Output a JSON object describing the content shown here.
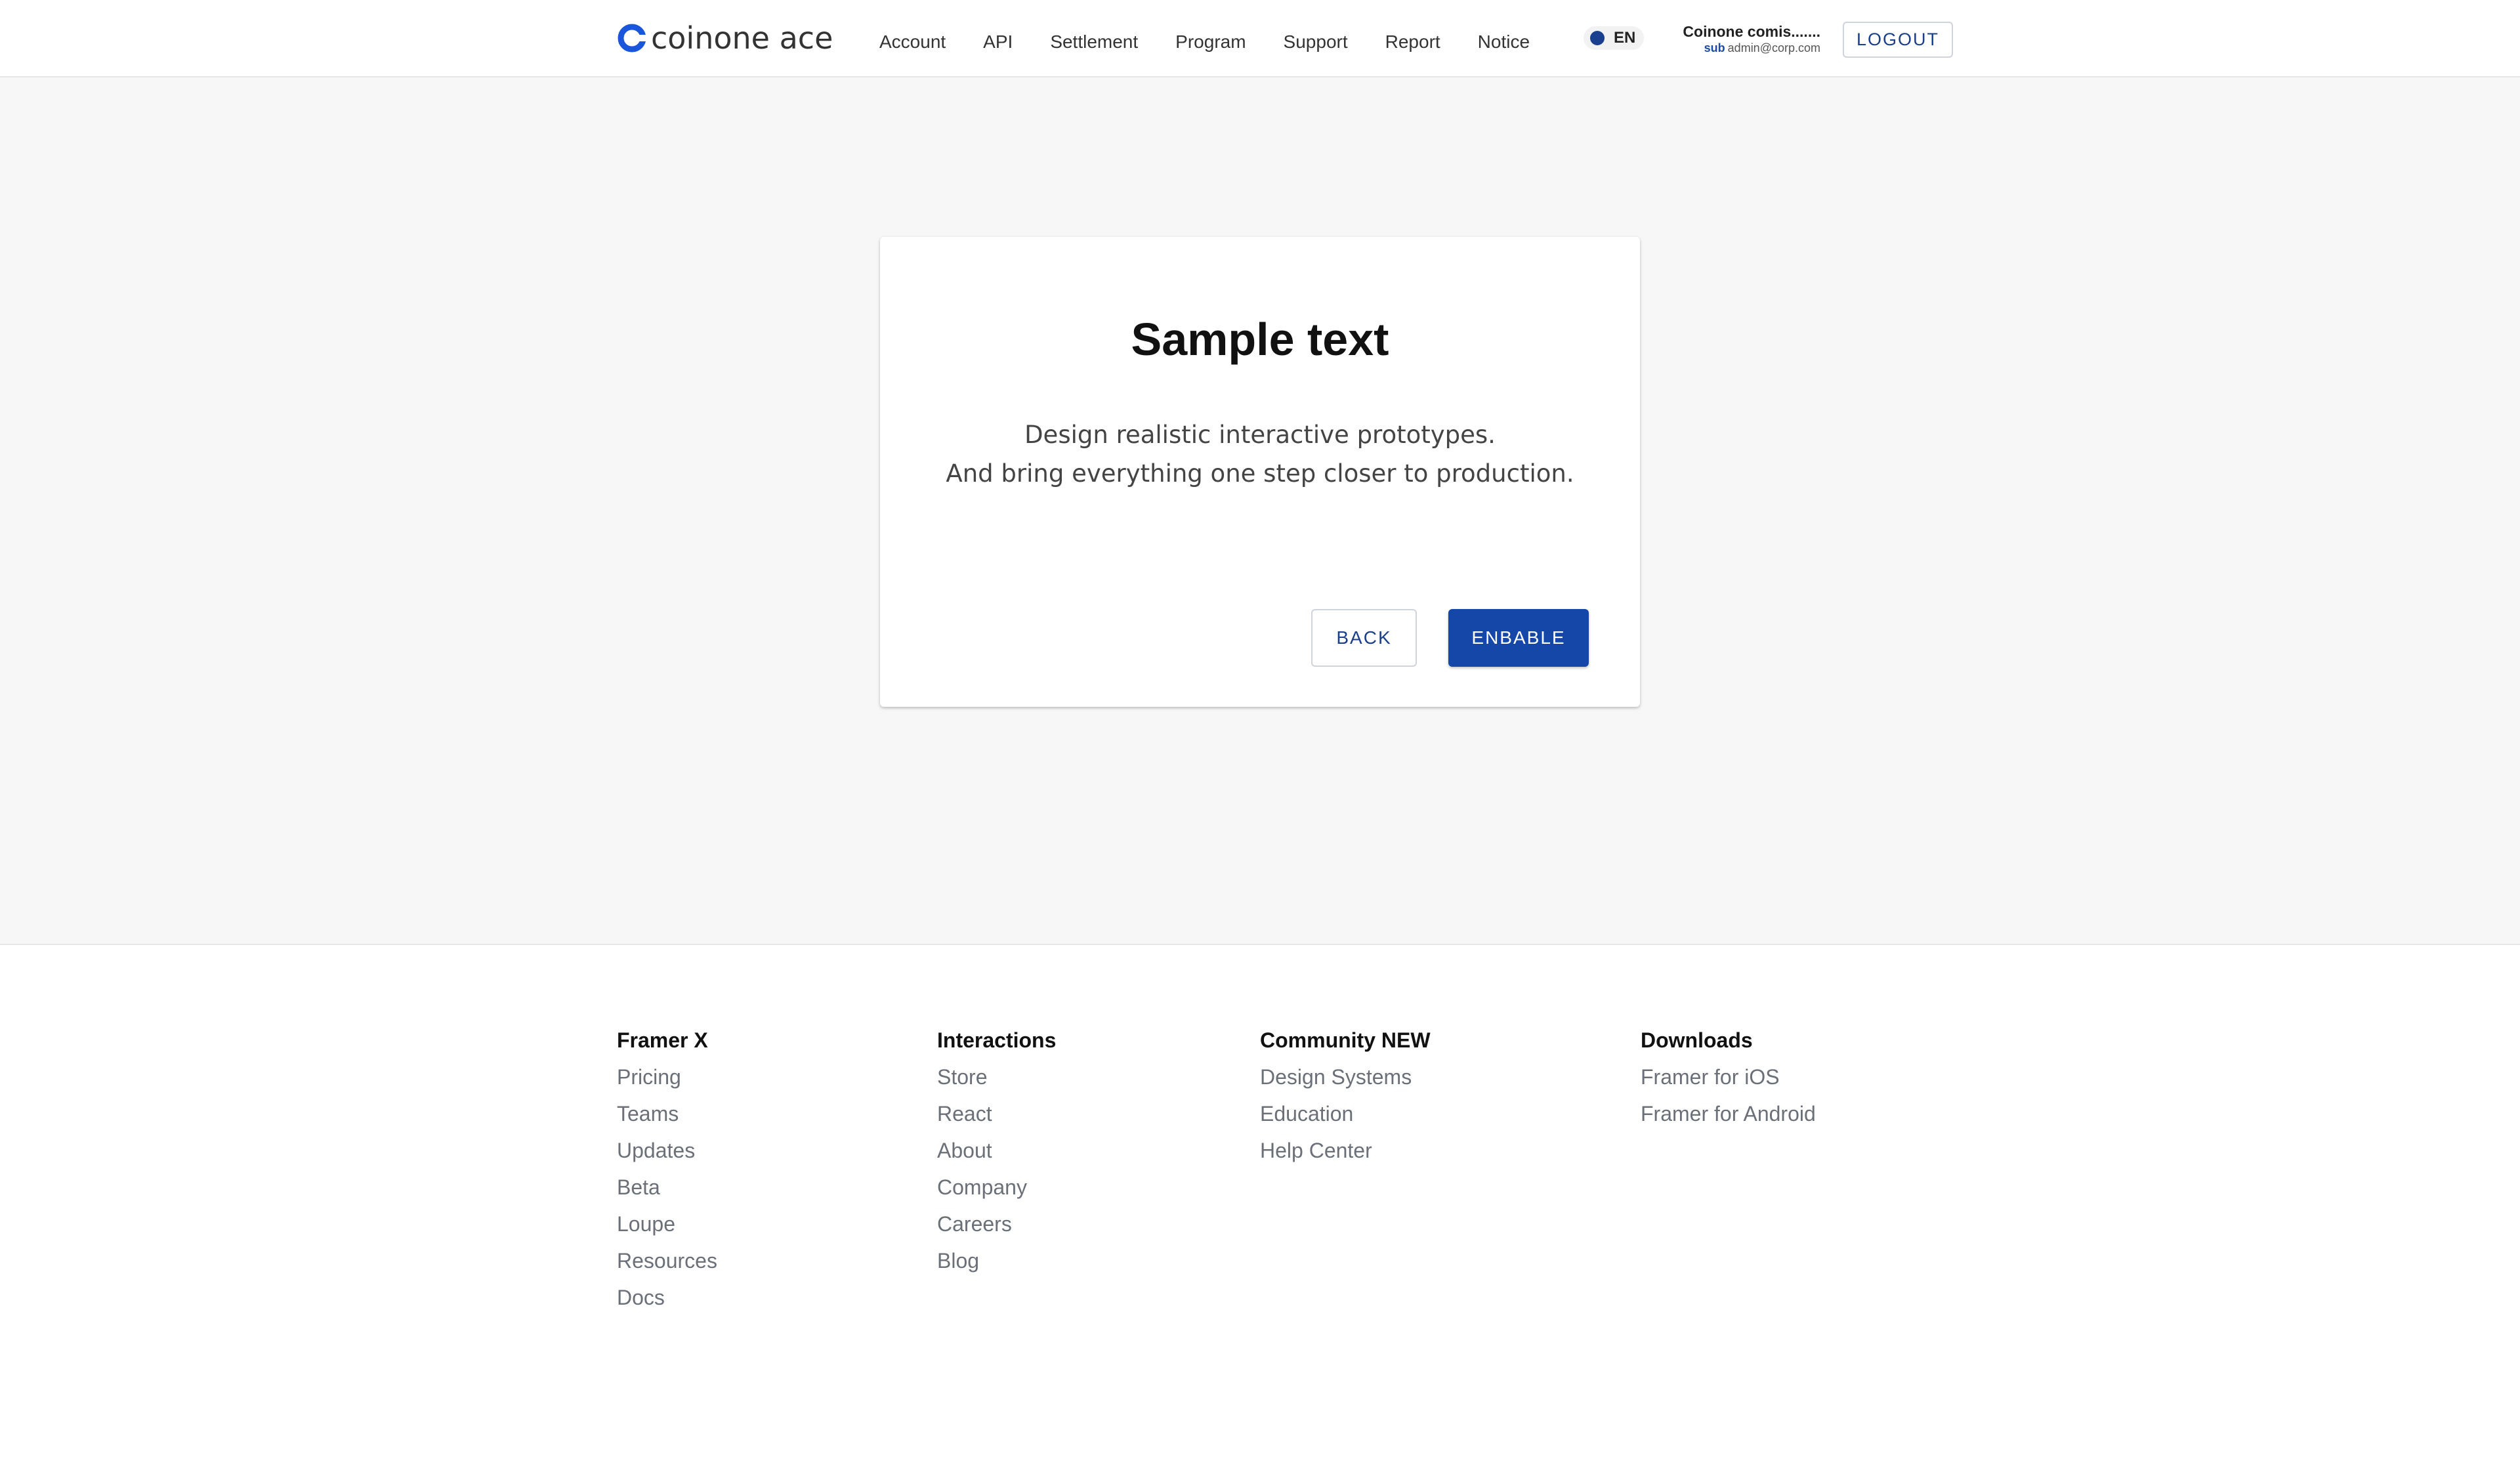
{
  "header": {
    "logo_text": "coinone ace",
    "brand_color": "#1a56db",
    "nav": [
      {
        "label": "Account"
      },
      {
        "label": "API"
      },
      {
        "label": "Settlement"
      },
      {
        "label": "Program"
      },
      {
        "label": "Support"
      },
      {
        "label": "Report"
      },
      {
        "label": "Notice"
      }
    ],
    "language": "EN",
    "user": {
      "name": "Coinone comis.......",
      "sub_tag": "sub",
      "email": "admin@corp.com"
    },
    "logout_label": "LOGOUT"
  },
  "card": {
    "title": "Sample text",
    "body_line1": "Design realistic interactive prototypes.",
    "body_line2": "And bring everything one step closer to production.",
    "back_label": "BACK",
    "enable_label": "ENBABLE",
    "accent_color": "#1547a8"
  },
  "footer": {
    "columns": [
      {
        "heading": "Framer X",
        "links": [
          "Pricing",
          "Teams",
          "Updates",
          "Beta",
          "Loupe",
          "Resources",
          "Docs"
        ]
      },
      {
        "heading": "Interactions",
        "links": [
          "Store",
          "React",
          "About",
          "Company",
          "Careers",
          "Blog"
        ]
      },
      {
        "heading": "Community NEW",
        "links": [
          "Design Systems",
          "Education",
          "Help Center"
        ]
      },
      {
        "heading": "Downloads",
        "links": [
          "Framer for iOS",
          "Framer for Android"
        ]
      }
    ]
  }
}
